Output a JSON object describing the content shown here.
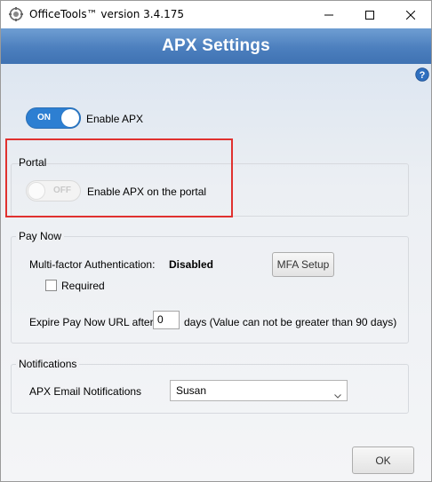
{
  "window": {
    "title": "OfficeTools™ version 3.4.175"
  },
  "header": {
    "title": "APX Settings"
  },
  "enable_apx": {
    "state_label": "ON",
    "label": "Enable APX",
    "enabled": true
  },
  "portal": {
    "group_title": "Portal",
    "toggle_state_label": "OFF",
    "toggle_label": "Enable APX on the portal",
    "enabled": false
  },
  "pay_now": {
    "group_title": "Pay Now",
    "mfa_label": "Multi-factor Authentication:",
    "mfa_status": "Disabled",
    "mfa_setup_button": "MFA Setup",
    "required_label": "Required",
    "required_checked": false,
    "expire_label": "Expire Pay Now URL after",
    "expire_value": "0",
    "expire_suffix": "days (Value can not be greater than 90 days)"
  },
  "notifications": {
    "group_title": "Notifications",
    "email_label": "APX Email Notifications",
    "email_selected": "Susan"
  },
  "footer": {
    "ok_button": "OK"
  },
  "colors": {
    "banner": "#4c7fbe",
    "toggle_on": "#2d7fd2",
    "highlight_outline": "#e0312f"
  },
  "icons": {
    "app": "officetools-app-icon",
    "minimize": "minimize-icon",
    "maximize": "maximize-icon",
    "close": "close-icon",
    "help": "help-icon",
    "dropdown": "chevron-down-icon"
  }
}
